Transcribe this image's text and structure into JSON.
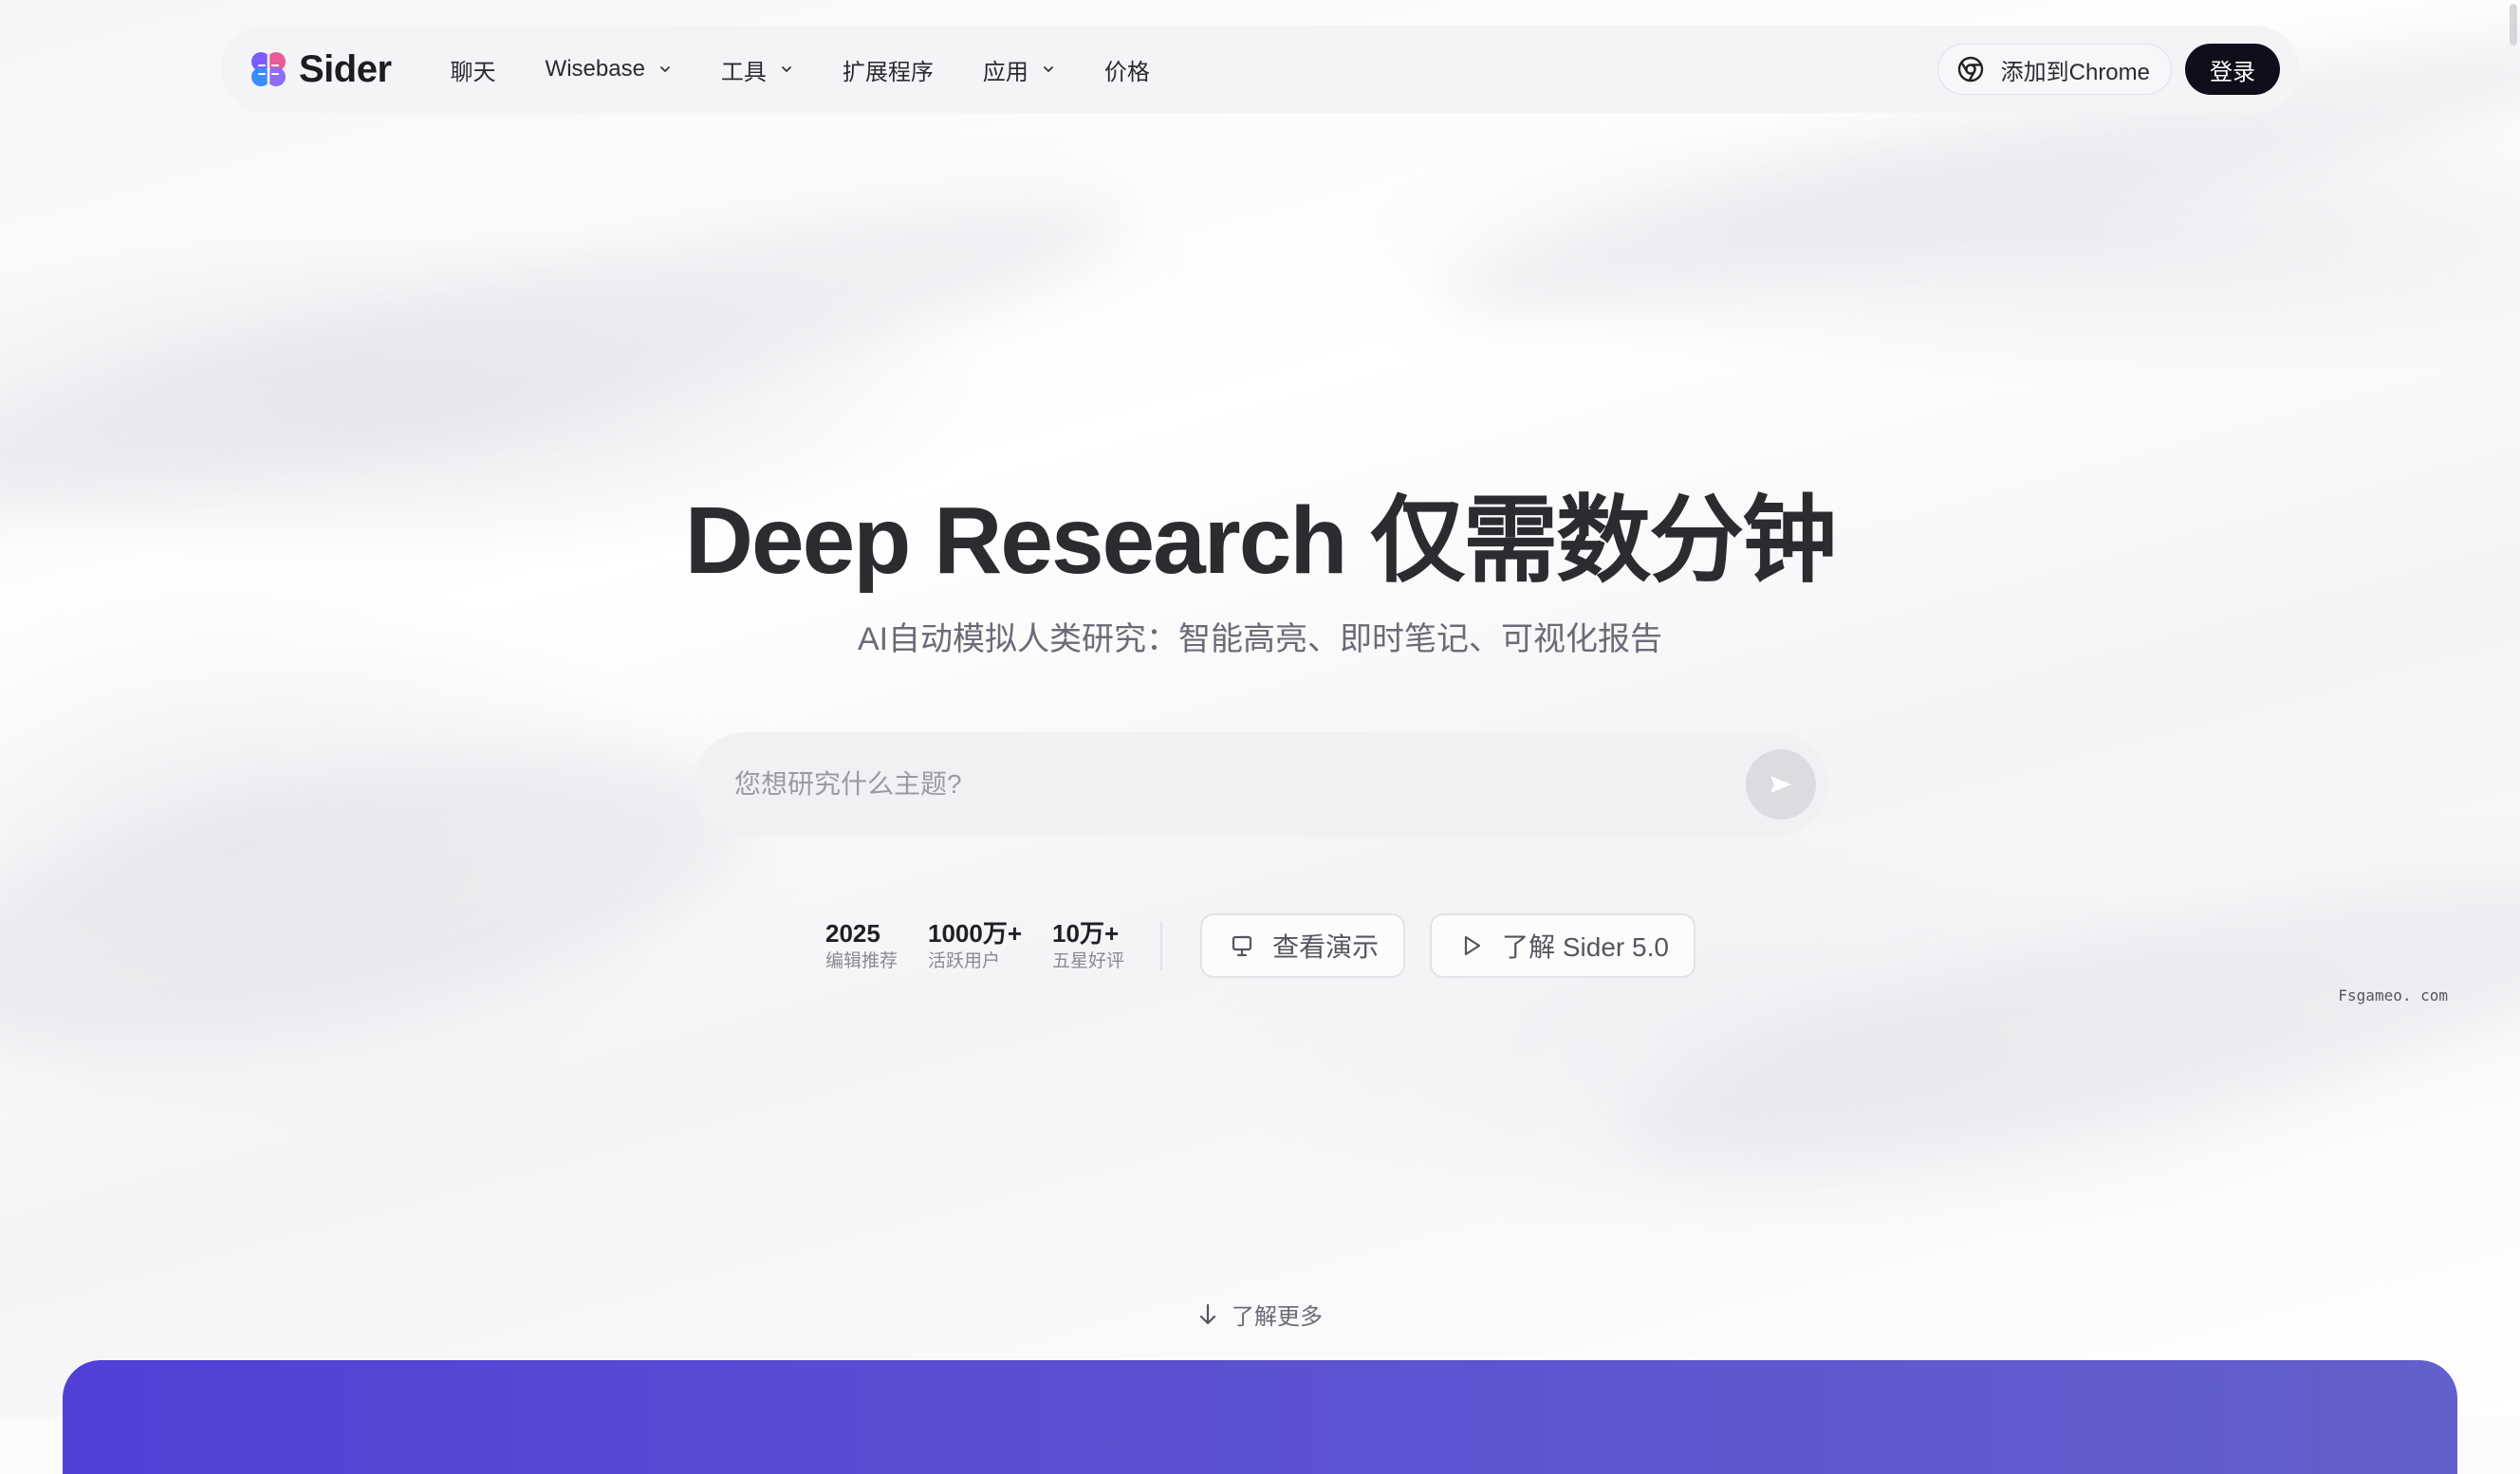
{
  "nav": {
    "brand": "Sider",
    "items": [
      {
        "label": "聊天",
        "has_dropdown": false
      },
      {
        "label": "Wisebase",
        "has_dropdown": true
      },
      {
        "label": "工具",
        "has_dropdown": true
      },
      {
        "label": "扩展程序",
        "has_dropdown": false
      },
      {
        "label": "应用",
        "has_dropdown": true
      },
      {
        "label": "价格",
        "has_dropdown": false
      }
    ],
    "chrome_button": "添加到Chrome",
    "login_button": "登录"
  },
  "hero": {
    "title": "Deep Research 仅需数分钟",
    "subtitle": "AI自动模拟人类研究：智能高亮、即时笔记、可视化报告",
    "search_placeholder": "您想研究什么主题?"
  },
  "stats": [
    {
      "value": "2025",
      "label": "编辑推荐"
    },
    {
      "value": "1000万+",
      "label": "活跃用户"
    },
    {
      "value": "10万+",
      "label": "五星好评"
    }
  ],
  "buttons": {
    "demo": "查看演示",
    "learn_sider": "了解 Sider 5.0"
  },
  "watermark": "Fsgameo. com",
  "learn_more": "了解更多",
  "colors": {
    "accent_dark": "#0e0f1a",
    "band_purple": "#5140d6"
  }
}
